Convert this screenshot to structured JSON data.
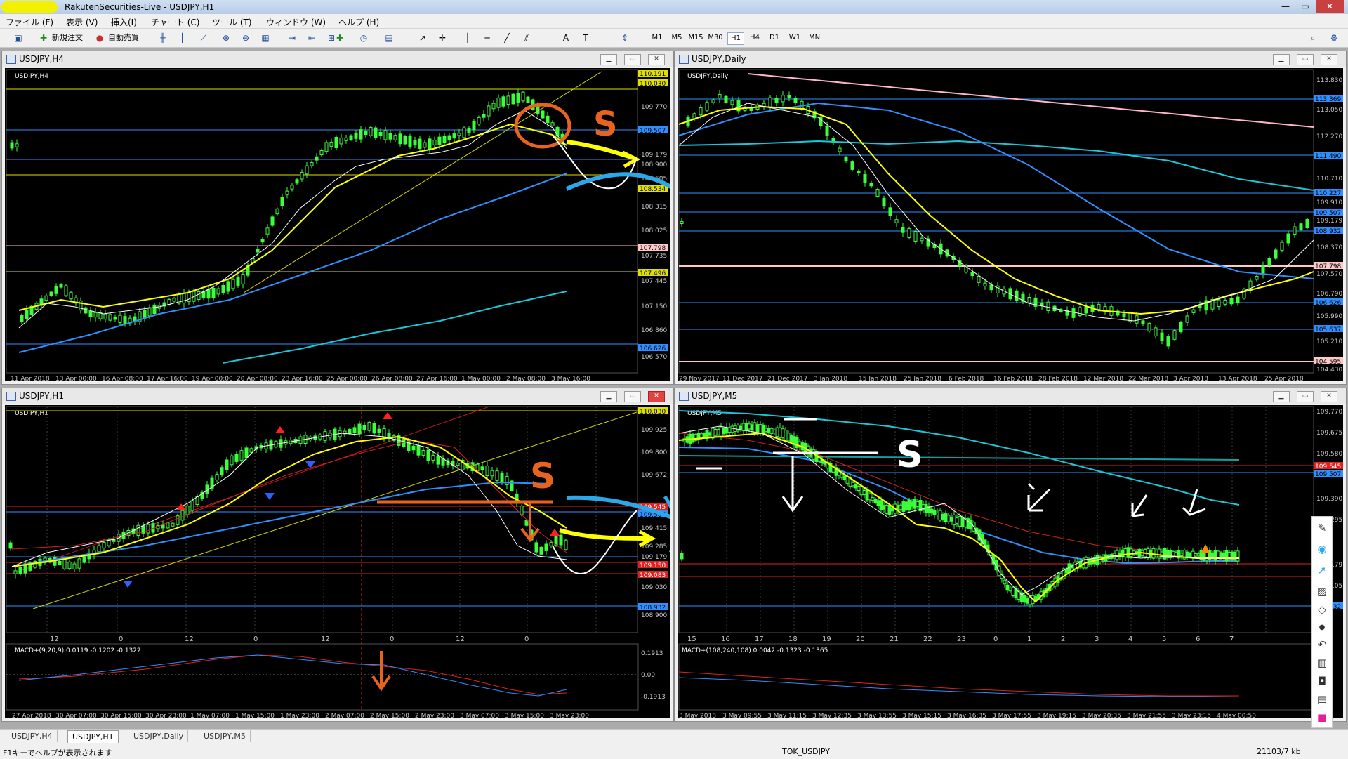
{
  "window": {
    "title": "RakutenSecurities-Live - USDJPY,H1",
    "controls": [
      "—",
      "▭",
      "✕"
    ]
  },
  "menu": [
    "ファイル (F)",
    "表示 (V)",
    "挿入(I)",
    "チャート (C)",
    "ツール (T)",
    "ウィンドウ (W)",
    "ヘルプ (H)"
  ],
  "toolbar": {
    "new_order": "新規注文",
    "auto_trade": "自動売買",
    "timeframes": [
      "M1",
      "M5",
      "M15",
      "M30",
      "H1",
      "H4",
      "D1",
      "W1",
      "MN"
    ],
    "active_timeframe": "H1",
    "text_tool": "A"
  },
  "charts": {
    "h4": {
      "title": "USDJPY,H4",
      "symbol_label": "USDJPY,H4",
      "price_labels": [
        "110.191",
        "110.030",
        "109.770",
        "109.507",
        "109.179",
        "108.900",
        "108.605",
        "108.534",
        "108.315",
        "108.025",
        "107.798",
        "107.735",
        "107.496",
        "107.445",
        "107.150",
        "106.860",
        "106.626",
        "106.570"
      ],
      "time_labels": [
        "11 Apr 2018",
        "13 Apr 00:00",
        "16 Apr 08:00",
        "17 Apr 16:00",
        "19 Apr 00:00",
        "20 Apr 08:00",
        "23 Apr 16:00",
        "25 Apr 00:00",
        "26 Apr 08:00",
        "27 Apr 16:00",
        "1 May 00:00",
        "2 May 08:00",
        "3 May 16:00"
      ],
      "annotation": "S"
    },
    "daily": {
      "title": "USDJPY,Daily",
      "symbol_label": "USDJPY,Daily",
      "price_labels": [
        "113.830",
        "113.369",
        "113.050",
        "112.270",
        "111.490",
        "110.710",
        "110.227",
        "109.910",
        "109.507",
        "109.179",
        "108.932",
        "108.370",
        "107.798",
        "107.570",
        "106.790",
        "106.626",
        "105.990",
        "105.637",
        "105.210",
        "104.595",
        "104.430"
      ],
      "time_labels": [
        "29 Nov 2017",
        "11 Dec 2017",
        "21 Dec 2017",
        "3 Jan 2018",
        "15 Jan 2018",
        "25 Jan 2018",
        "6 Feb 2018",
        "16 Feb 2018",
        "28 Feb 2018",
        "12 Mar 2018",
        "22 Mar 2018",
        "3 Apr 2018",
        "13 Apr 2018",
        "25 Apr 2018"
      ]
    },
    "h1": {
      "title": "USDJPY,H1",
      "symbol_label": "USDJPY,H1",
      "price_labels": [
        "110.030",
        "109.925",
        "109.800",
        "109.672",
        "109.545",
        "109.507",
        "109.415",
        "109.285",
        "109.179",
        "109.150",
        "109.083",
        "109.030",
        "108.932",
        "108.900"
      ],
      "hour_labels": [
        "12",
        "0",
        "12",
        "0",
        "12",
        "0",
        "12",
        "0"
      ],
      "time_labels": [
        "27 Apr 2018",
        "30 Apr 07:00",
        "30 Apr 15:00",
        "30 Apr 23:00",
        "1 May 07:00",
        "1 May 15:00",
        "1 May 23:00",
        "2 May 07:00",
        "2 May 15:00",
        "2 May 23:00",
        "3 May 07:00",
        "3 May 15:00",
        "3 May 23:00"
      ],
      "macd_label": "MACD+(9,20,9) 0.0119 -0.1202 -0.1322",
      "macd_levels": [
        "0.1913",
        "0.00",
        "-0.1913"
      ],
      "annotation": "S"
    },
    "m5": {
      "title": "USDJPY,M5",
      "symbol_label": "USDJPY,M5",
      "price_labels": [
        "109.770",
        "109.675",
        "109.580",
        "109.545",
        "109.507",
        "109.390",
        "109.295",
        "109.179",
        "109.105",
        "108.932"
      ],
      "hour_labels": [
        "15",
        "16",
        "17",
        "18",
        "19",
        "20",
        "21",
        "22",
        "23",
        "0",
        "1",
        "2",
        "3",
        "4",
        "5",
        "6",
        "7"
      ],
      "time_labels": [
        "3 May 2018",
        "3 May 09:55",
        "3 May 11:15",
        "3 May 12:35",
        "3 May 13:55",
        "3 May 15:15",
        "3 May 16:35",
        "3 May 17:55",
        "3 May 19:15",
        "3 May 20:35",
        "3 May 21:55",
        "3 May 23:15",
        "4 May 00:50"
      ],
      "macd_label": "MACD+(108,240,108) 0.0042 -0.1323 -0.1365",
      "annotation": "S"
    }
  },
  "tabs": [
    "USDJPY,H4",
    "USDJPY,H1",
    "USDJPY,Daily",
    "USDJPY,M5"
  ],
  "active_tab": "USDJPY,H1",
  "status": {
    "help": "F1キーでヘルプが表示されます",
    "profile": "TOK_USDJPY",
    "traffic": "21103/7 kb"
  },
  "colors": {
    "chart_bg": "#000000",
    "bull_candle": "#3CFF3C",
    "ma_yellow": "#FFFF00",
    "ma_blue": "#2F8FFF",
    "ma_cyan": "#18C8D8",
    "line_white": "#FFFFFF",
    "annotation_orange": "#E8641E",
    "annotation_cyan": "#2BA8E8"
  }
}
